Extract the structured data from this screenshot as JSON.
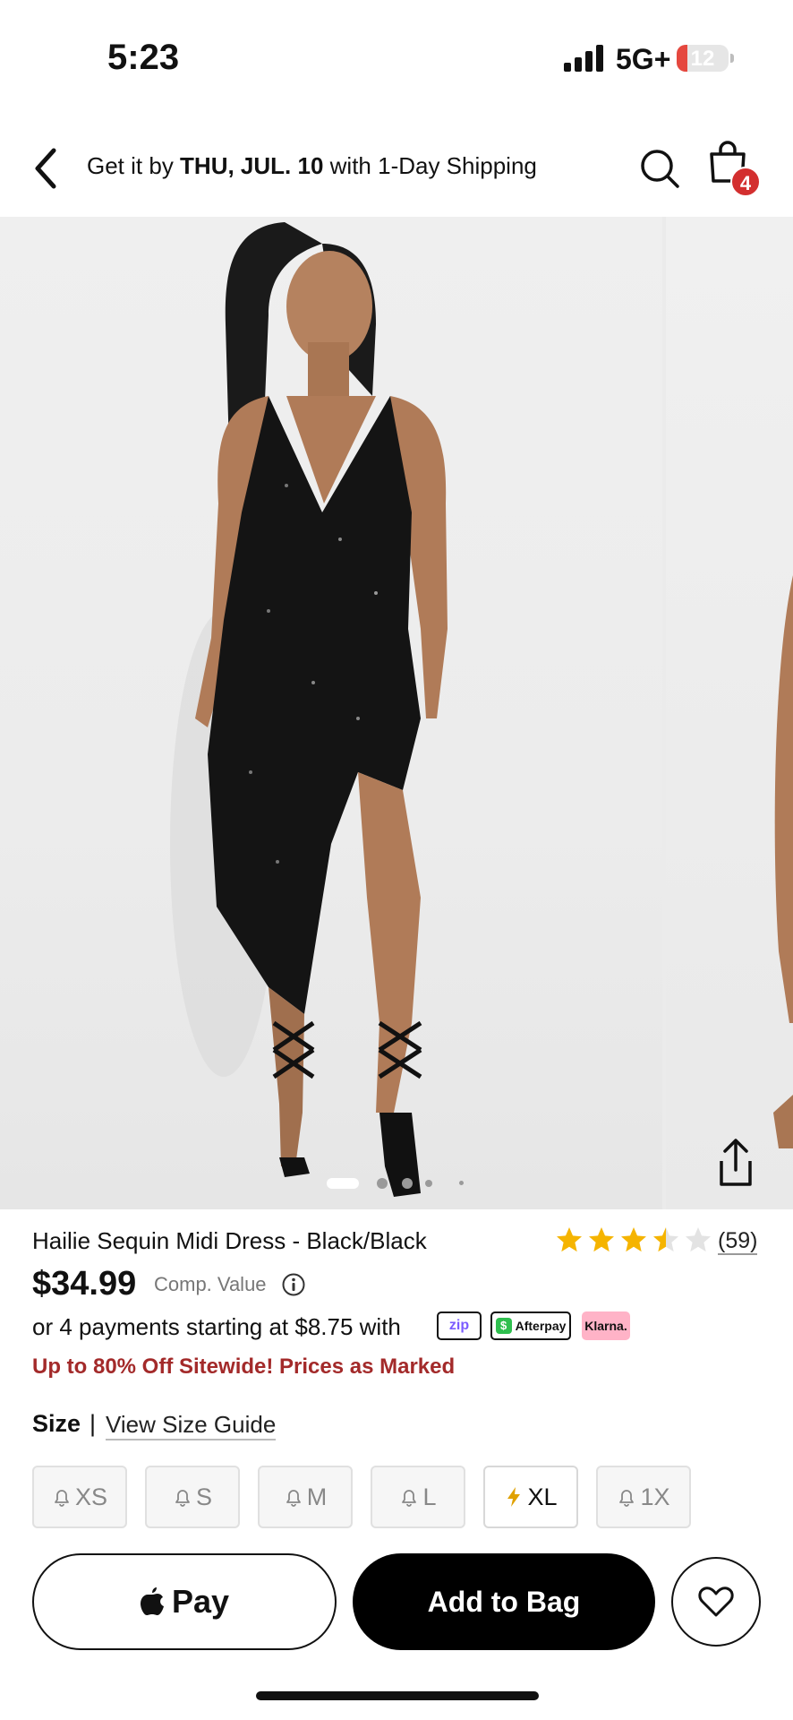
{
  "status_bar": {
    "time": "5:23",
    "network": "5G+",
    "battery": "12"
  },
  "header": {
    "shipping_prefix": "Get it by ",
    "shipping_date": "THU, JUL. 10",
    "shipping_suffix": " with 1-Day Shipping",
    "bag_count": "4"
  },
  "gallery": {
    "image_count": 5,
    "active_index": 0
  },
  "product": {
    "name": "Hailie Sequin Midi Dress - Black/Black",
    "rating": 3.5,
    "rating_max": 5,
    "review_count": "(59)",
    "price": "$34.99",
    "comp_value_label": "Comp. Value",
    "payments_text": "or 4 payments starting at $8.75 with",
    "payment_providers": {
      "zip": "zip",
      "afterpay": "Afterpay",
      "klarna": "Klarna."
    },
    "promo": "Up to 80% Off Sitewide! Prices as Marked"
  },
  "size": {
    "label": "Size",
    "separator": "|",
    "guide_link": "View Size Guide",
    "options": [
      {
        "label": "XS",
        "icon": "bell-icon"
      },
      {
        "label": "S",
        "icon": "bell-icon"
      },
      {
        "label": "M",
        "icon": "bell-icon"
      },
      {
        "label": "L",
        "icon": "bell-icon"
      },
      {
        "label": "XL",
        "icon": "lightning-icon"
      },
      {
        "label": "1X",
        "icon": "bell-icon"
      }
    ]
  },
  "actions": {
    "apple_pay": "Pay",
    "add_to_bag": "Add to Bag"
  },
  "colors": {
    "promo": "#a32a2a",
    "badge": "#d32f2f",
    "star": "#f5b400",
    "lightning": "#e0a100"
  }
}
